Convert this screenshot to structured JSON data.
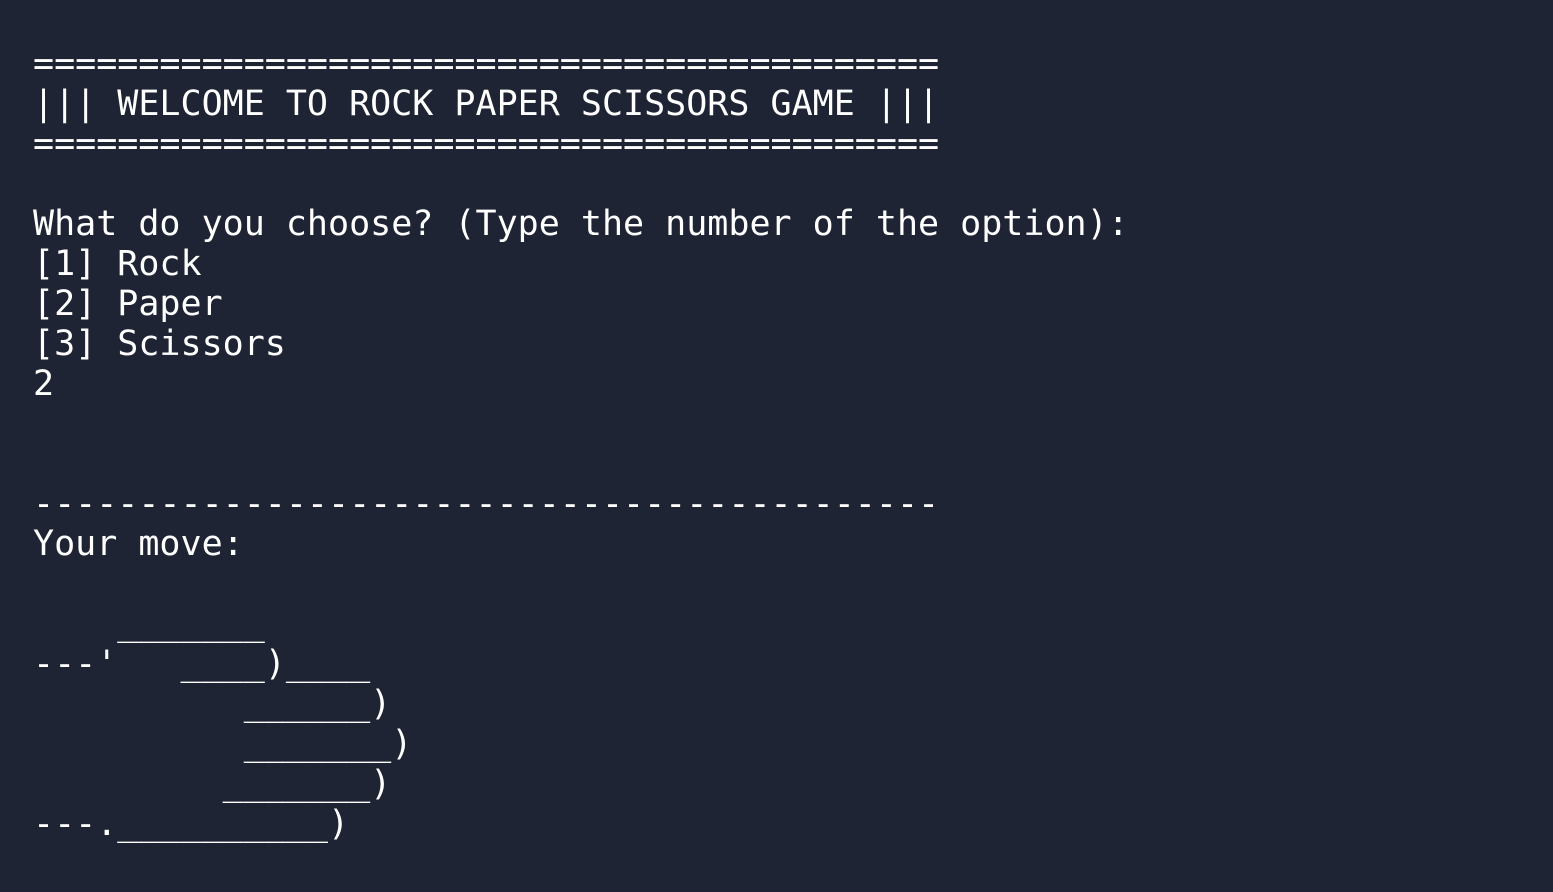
{
  "terminal": {
    "banner": {
      "top_rule": "===========================================",
      "title": "||| WELCOME TO ROCK PAPER SCISSORS GAME |||",
      "bottom_rule": "==========================================="
    },
    "prompt": {
      "question": "What do you choose? (Type the number of the option):",
      "options": [
        "[1] Rock",
        "[2] Paper",
        "[3] Scissors"
      ],
      "user_input": "2"
    },
    "result": {
      "separator": "-------------------------------------------",
      "label": "Your move:",
      "ascii_art": [
        "    _______",
        "---'   ____)____",
        "          ______)",
        "          _______)",
        "         _______)",
        "---.__________)"
      ]
    }
  }
}
